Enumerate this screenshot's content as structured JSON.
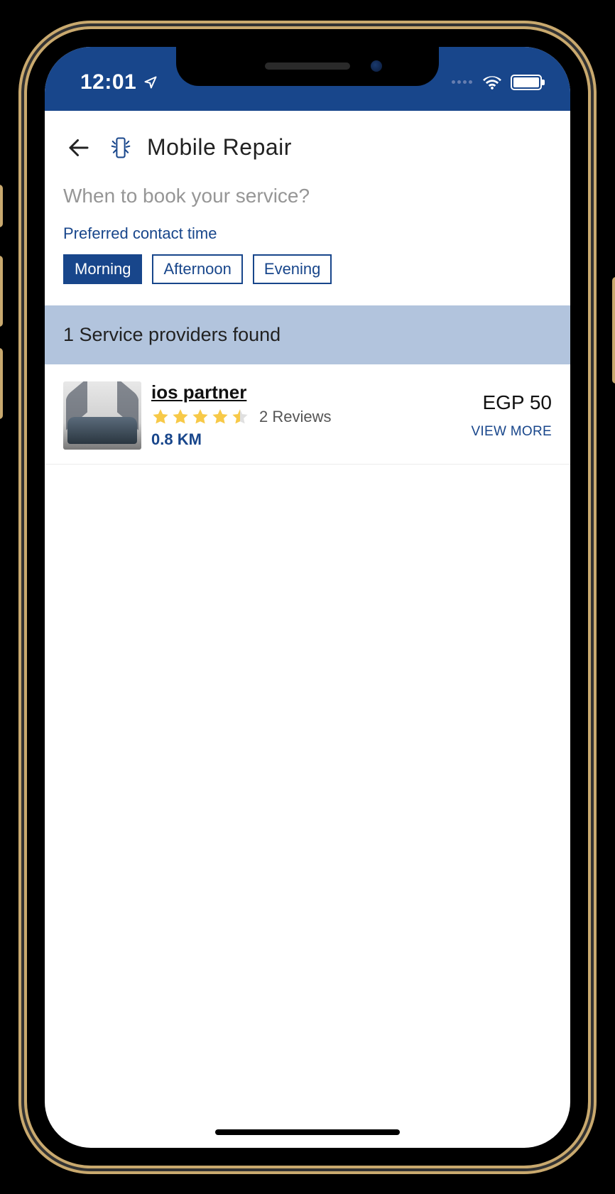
{
  "status": {
    "time": "12:01"
  },
  "header": {
    "title": "Mobile Repair"
  },
  "booking": {
    "question": "When to book your service?",
    "contact_label": "Preferred contact time",
    "options": [
      "Morning",
      "Afternoon",
      "Evening"
    ],
    "selected": "Morning"
  },
  "results": {
    "banner": "1 Service providers found",
    "providers": [
      {
        "name": "ios partner",
        "rating": 4.5,
        "reviews_text": "2 Reviews",
        "distance": "0.8 KM",
        "price": "EGP 50",
        "view_more": "VIEW MORE"
      }
    ]
  }
}
